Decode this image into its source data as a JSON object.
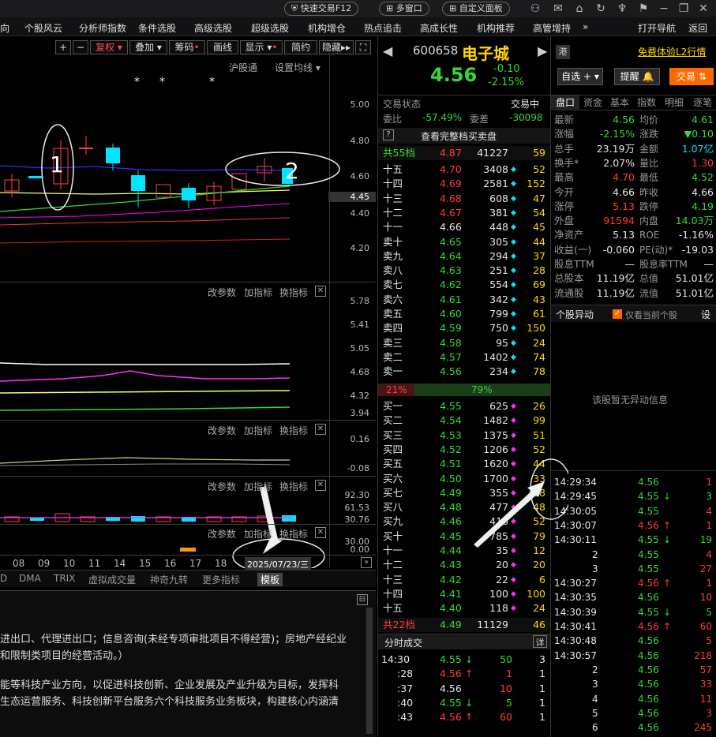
{
  "titlebar": {
    "quick_trade": "快速交易F12",
    "multi_window": "多窗口",
    "custom_panel": "自定义面板"
  },
  "menu": [
    "向",
    "个股风云",
    "分析师指数",
    "条件选股",
    "高级选股",
    "超级选股",
    "机构增仓",
    "热点追击",
    "高成长性",
    "机构推荐",
    "高管增持",
    "»",
    "打开导航",
    "返回"
  ],
  "chart": {
    "toolbar": [
      "+",
      "−",
      "复权",
      "叠加",
      "筹码",
      "画线",
      "显示",
      "简约",
      "隐藏"
    ],
    "sub_toolbar": [
      "沪股通",
      "设置均线"
    ],
    "price_axis": [
      "5.00",
      "4.80",
      "4.60",
      "4.45",
      "4.40",
      "4.20"
    ],
    "ind1_axis": [
      "5.78",
      "5.41",
      "5.05",
      "4.68",
      "4.32",
      "3.94"
    ],
    "ind2_axis": [
      "0.16",
      "-0.08"
    ],
    "ind3_axis": [
      "92.30",
      "61.53",
      "30.76",
      "0.00"
    ],
    "ind4_axis": [
      "30.00",
      "0.00"
    ],
    "panel_actions": [
      "改参数",
      "加指标",
      "换指标"
    ],
    "dates": [
      "08",
      "09",
      "10",
      "11",
      "14",
      "15",
      "16",
      "17",
      "18"
    ],
    "selected_date": "2025/07/23/三",
    "annotation_1": "1",
    "annotation_2": "2",
    "bottom_tabs": [
      "D",
      "DMA",
      "TRIX",
      "虚拟成交量",
      "神奇九转",
      "更多指标",
      "模板"
    ],
    "company_info": [
      "进出口、代理进出口；信息咨询(未经专项审批项目不得经营)；房地产经纪业",
      "和限制类项目的经营活动。）",
      "",
      "能等科技产业方向，以促进科技创新、企业发展及产业升级为目标，发挥科",
      "生态运营服务、科技创新平台服务六个科技服务业务板块，构建核心内涵清"
    ]
  },
  "stock": {
    "code": "600658",
    "name": "电子城",
    "price": "4.56",
    "change": "-0.10",
    "change_pct": "-2.15%",
    "hk_tag": "港",
    "l2_link": "免费体验L2行情",
    "watch_btn": "自选",
    "remind_btn": "提醒",
    "trade_btn": "交易",
    "status_label": "交易状态",
    "status_value": "交易中",
    "weibi_label": "委比",
    "weibi_value": "-57.49%",
    "weicha_label": "委差",
    "weicha_value": "-30098",
    "full_book_link": "查看完整档买卖盘",
    "ask_total_label": "共55档",
    "ask_total_price": "4.87",
    "ask_total_vol": "41227",
    "ask_total_count": "59",
    "bid_total_label": "共22档",
    "bid_total_price": "4.49",
    "bid_total_vol": "11129",
    "bid_total_count": "46",
    "ratio_left": "21%",
    "ratio_right": "79%",
    "trades_label": "分时成交",
    "trades_detail": "详"
  },
  "asks": [
    {
      "lvl": "十五",
      "price": "4.70",
      "vol": "3408",
      "dot": "cyan",
      "cnt": "52"
    },
    {
      "lvl": "十四",
      "price": "4.69",
      "vol": "2581",
      "dot": "cyan",
      "cnt": "152"
    },
    {
      "lvl": "十三",
      "price": "4.68",
      "vol": "608",
      "dot": "cyan",
      "cnt": "47"
    },
    {
      "lvl": "十二",
      "price": "4.67",
      "vol": "381",
      "dot": "cyan",
      "cnt": "54"
    },
    {
      "lvl": "十一",
      "price": "4.66",
      "vol": "448",
      "dot": "cyan",
      "cnt": "45"
    },
    {
      "lvl": "卖十",
      "price": "4.65",
      "vol": "305",
      "dot": "cyan",
      "cnt": "44"
    },
    {
      "lvl": "卖九",
      "price": "4.64",
      "vol": "294",
      "dot": "cyan",
      "cnt": "37"
    },
    {
      "lvl": "卖八",
      "price": "4.63",
      "vol": "251",
      "dot": "cyan",
      "cnt": "28"
    },
    {
      "lvl": "卖七",
      "price": "4.62",
      "vol": "554",
      "dot": "cyan",
      "cnt": "69"
    },
    {
      "lvl": "卖六",
      "price": "4.61",
      "vol": "342",
      "dot": "cyan",
      "cnt": "43"
    },
    {
      "lvl": "卖五",
      "price": "4.60",
      "vol": "799",
      "dot": "cyan",
      "cnt": "61"
    },
    {
      "lvl": "卖四",
      "price": "4.59",
      "vol": "750",
      "dot": "cyan",
      "cnt": "150"
    },
    {
      "lvl": "卖三",
      "price": "4.58",
      "vol": "95",
      "dot": "cyan",
      "cnt": "24"
    },
    {
      "lvl": "卖二",
      "price": "4.57",
      "vol": "1402",
      "dot": "cyan",
      "cnt": "74"
    },
    {
      "lvl": "卖一",
      "price": "4.56",
      "vol": "234",
      "dot": "cyan",
      "cnt": "78"
    }
  ],
  "bids": [
    {
      "lvl": "买一",
      "price": "4.55",
      "vol": "625",
      "dot": "magenta",
      "cnt": "26"
    },
    {
      "lvl": "买二",
      "price": "4.54",
      "vol": "1482",
      "dot": "magenta",
      "cnt": "99"
    },
    {
      "lvl": "买三",
      "price": "4.53",
      "vol": "1375",
      "dot": "magenta",
      "cnt": "51"
    },
    {
      "lvl": "买四",
      "price": "4.52",
      "vol": "1206",
      "dot": "magenta",
      "cnt": "52"
    },
    {
      "lvl": "买五",
      "price": "4.51",
      "vol": "1620",
      "dot": "magenta",
      "cnt": "44"
    },
    {
      "lvl": "买六",
      "price": "4.50",
      "vol": "1700",
      "dot": "magenta",
      "cnt": "33"
    },
    {
      "lvl": "买七",
      "price": "4.49",
      "vol": "355",
      "dot": "magenta",
      "cnt": "68"
    },
    {
      "lvl": "买八",
      "price": "4.48",
      "vol": "477",
      "dot": "magenta",
      "cnt": "48"
    },
    {
      "lvl": "买九",
      "price": "4.46",
      "vol": "416",
      "dot": "magenta",
      "cnt": "52"
    },
    {
      "lvl": "买十",
      "price": "4.45",
      "vol": "785",
      "dot": "magenta",
      "cnt": "79"
    },
    {
      "lvl": "十一",
      "price": "4.44",
      "vol": "35",
      "dot": "magenta",
      "cnt": "12"
    },
    {
      "lvl": "十二",
      "price": "4.43",
      "vol": "20",
      "dot": "magenta",
      "cnt": "20"
    },
    {
      "lvl": "十三",
      "price": "4.42",
      "vol": "22",
      "dot": "magenta",
      "cnt": "6"
    },
    {
      "lvl": "十四",
      "price": "4.41",
      "vol": "100",
      "dot": "magenta",
      "cnt": "100"
    },
    {
      "lvl": "十五",
      "price": "4.40",
      "vol": "118",
      "dot": "magenta",
      "cnt": "24"
    }
  ],
  "trades_left": [
    {
      "t": "14:30",
      "p": "4.55",
      "dir": "down",
      "v": "50",
      "n": "3"
    },
    {
      "t": ":28",
      "p": "4.56",
      "dir": "up",
      "v": "1",
      "n": "1"
    },
    {
      "t": ":37",
      "p": "4.56",
      "dir": "",
      "v": "10",
      "n": "1"
    },
    {
      "t": ":40",
      "p": "4.55",
      "dir": "down",
      "v": "5",
      "n": "1"
    },
    {
      "t": ":43",
      "p": "4.56",
      "dir": "up",
      "v": "60",
      "n": "1"
    }
  ],
  "rtabs": [
    "盘口",
    "资金",
    "基本",
    "指数",
    "明细",
    "逐笔"
  ],
  "stats": [
    [
      "最新",
      "4.56",
      "均价",
      "4.61"
    ],
    [
      "涨幅",
      "-2.15%",
      "涨跌",
      "▼0.10"
    ],
    [
      "总手",
      "23.19万",
      "金额",
      "1.07亿"
    ],
    [
      "换手*",
      "2.07%",
      "量比",
      "1.30"
    ],
    [
      "最高",
      "4.70",
      "最低",
      "4.52"
    ],
    [
      "今开",
      "4.66",
      "昨收",
      "4.66"
    ],
    [
      "涨停",
      "5.13",
      "跌停",
      "4.19"
    ],
    [
      "外盘",
      "91594",
      "内盘",
      "14.03万"
    ],
    [
      "净资产",
      "5.13",
      "ROE",
      "-1.16%"
    ],
    [
      "收益(一)",
      "-0.060",
      "PE(动)*",
      "-19.03"
    ],
    [
      "股息TTM",
      "—",
      "股息率TTM",
      "—"
    ],
    [
      "总股本",
      "11.19亿",
      "总值",
      "51.01亿"
    ],
    [
      "流通股",
      "11.19亿",
      "流值",
      "51.01亿"
    ]
  ],
  "anomaly": {
    "title": "个股异动",
    "checkbox": "仅看当前个股",
    "settings": "设",
    "empty": "该股暂无异动信息"
  },
  "ticks": [
    {
      "t": "14:29:34",
      "p": "4.56",
      "dir": "",
      "v": "1"
    },
    {
      "t": "14:29:45",
      "p": "4.55",
      "dir": "down",
      "v": "3"
    },
    {
      "t": "14:30:05",
      "p": "4.55",
      "dir": "",
      "v": "4"
    },
    {
      "t": "14:30:07",
      "p": "4.56",
      "dir": "up",
      "v": "1"
    },
    {
      "t": "14:30:11",
      "p": "4.55",
      "dir": "down",
      "v": "19"
    },
    {
      "t": "2",
      "p": "4.55",
      "dir": "",
      "v": "4"
    },
    {
      "t": "3",
      "p": "4.55",
      "dir": "",
      "v": "27"
    },
    {
      "t": "14:30:27",
      "p": "4.56",
      "dir": "up",
      "v": "1"
    },
    {
      "t": "14:30:35",
      "p": "4.56",
      "dir": "",
      "v": "10"
    },
    {
      "t": "14:30:39",
      "p": "4.55",
      "dir": "down",
      "v": "5"
    },
    {
      "t": "14:30:41",
      "p": "4.56",
      "dir": "up",
      "v": "60"
    },
    {
      "t": "14:30:48",
      "p": "4.56",
      "dir": "",
      "v": "5"
    },
    {
      "t": "14:30:57",
      "p": "4.56",
      "dir": "",
      "v": "218"
    },
    {
      "t": "2",
      "p": "4.56",
      "dir": "",
      "v": "57"
    },
    {
      "t": "3",
      "p": "4.56",
      "dir": "",
      "v": "33"
    },
    {
      "t": "4",
      "p": "4.56",
      "dir": "",
      "v": "11"
    },
    {
      "t": "5",
      "p": "4.56",
      "dir": "",
      "v": "3"
    },
    {
      "t": "6",
      "p": "4.56",
      "dir": "",
      "v": "245"
    }
  ],
  "colors": {
    "up": "#ff3b3b",
    "down": "#35d835",
    "accent": "#ff6a00",
    "cyan": "#00e5ff",
    "magenta": "#ff2bff"
  }
}
